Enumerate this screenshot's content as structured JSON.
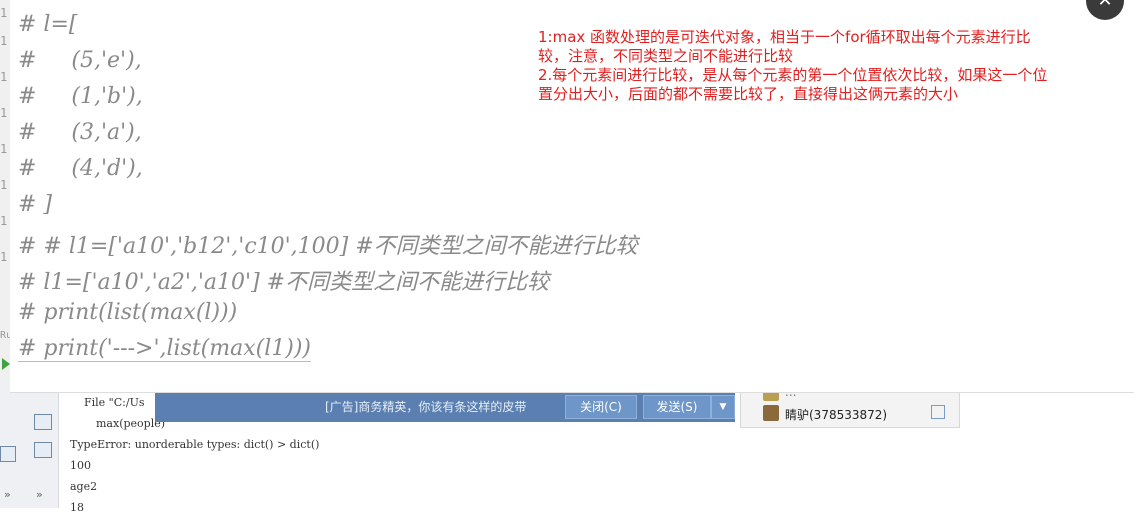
{
  "code_lines": [
    "# l=[",
    "#     (5,'e'),",
    "#     (1,'b'),",
    "#     (3,'a'),",
    "#     (4,'d'),",
    "# ]",
    "# # l1=['a10','b12','c10',100] #不同类型之间不能进行比较",
    "# l1=['a10','a2','a10'] #不同类型之间不能进行比较",
    "# print(list(max(l)))",
    "# print('--->',list(max(l1)))"
  ],
  "note": {
    "line1": "1:max 函数处理的是可迭代对象，相当于一个for循环取出每个元素进行比",
    "line2": "较，注意，不同类型之间不能进行比较",
    "line3": "2.每个元素间进行比较，是从每个元素的第一个位置依次比较，如果这一个位",
    "line4": "置分出大小，后面的都不需要比较了，直接得出这俩元素的大小"
  },
  "console": {
    "file_prefix": "File \"C:/Us",
    "call": "max(people)",
    "error": "TypeError: unorderable types: dict() > dict()",
    "out1": "100",
    "out2": "age2",
    "out3": "18"
  },
  "ad": {
    "text": "[广告]商务精英，你该有条这样的皮带",
    "close_label": "关闭(C)",
    "send_label": "发送(S)",
    "dropdown": "▼"
  },
  "chat": {
    "contact1": "...",
    "contact2": "睛驴(378533872)"
  },
  "gutter": {
    "g1": "1",
    "g2": "1",
    "g3": "1",
    "g4": "1",
    "g5": "1",
    "g6": "1",
    "g7": "1",
    "g8": "1",
    "g9": "Ru"
  },
  "sidebar_glyphs": {
    "chev1": "»",
    "chev2": "»"
  },
  "close_glyph": "✕"
}
